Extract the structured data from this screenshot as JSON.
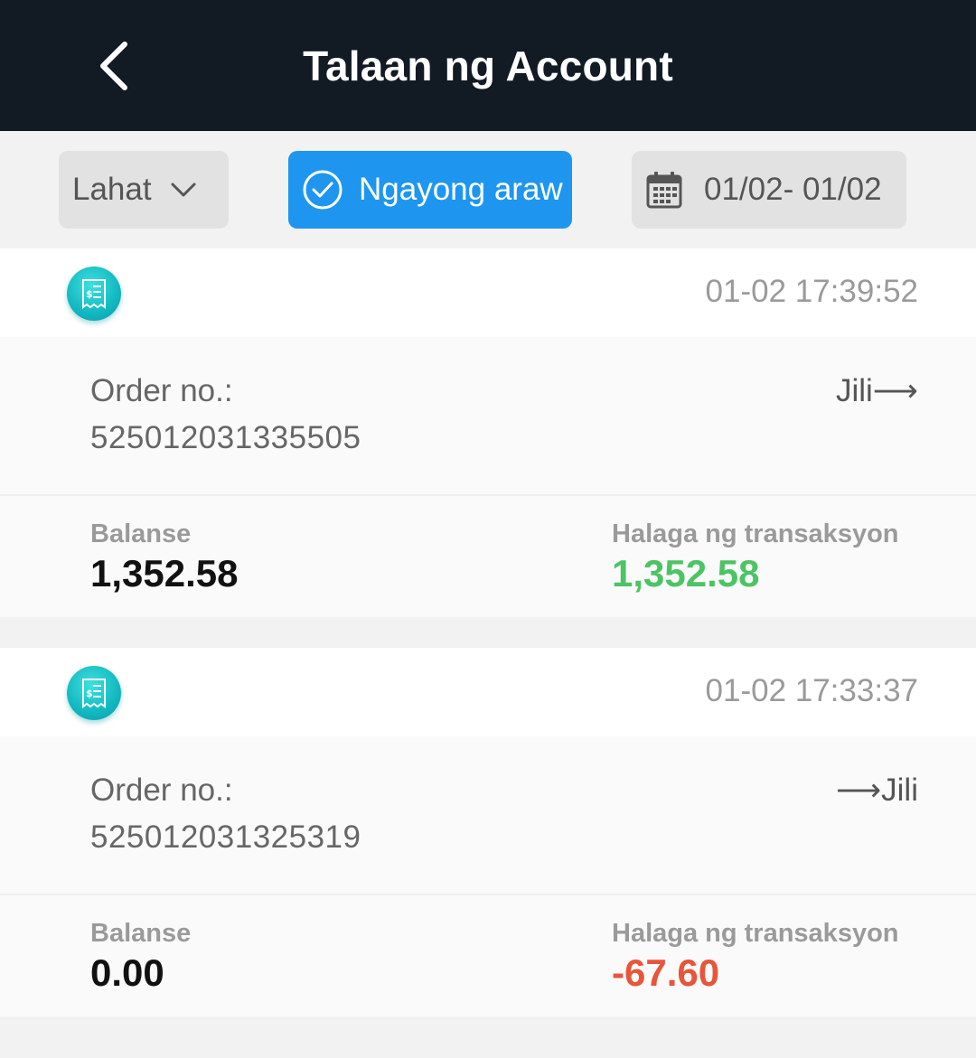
{
  "header": {
    "title": "Talaan ng Account"
  },
  "filters": {
    "type_label": "Lahat",
    "today_label": "Ngayong araw",
    "date_range": "01/02- 01/02"
  },
  "colors": {
    "accent": "#1e96f0",
    "positive": "#4cc464",
    "negative": "#e8553a",
    "header_bg": "#121a24"
  },
  "records": [
    {
      "time": "01-02 17:39:52",
      "order_label": "Order no.:",
      "order_no": "525012031335505",
      "transfer": "Jili⟶",
      "balance_label": "Balanse",
      "balance": "1,352.58",
      "amount_label": "Halaga ng transaksyon",
      "amount": "1,352.58",
      "amount_sign": "positive"
    },
    {
      "time": "01-02 17:33:37",
      "order_label": "Order no.:",
      "order_no": "525012031325319",
      "transfer": "⟶Jili",
      "balance_label": "Balanse",
      "balance": "0.00",
      "amount_label": "Halaga ng transaksyon",
      "amount": "-67.60",
      "amount_sign": "negative"
    }
  ]
}
